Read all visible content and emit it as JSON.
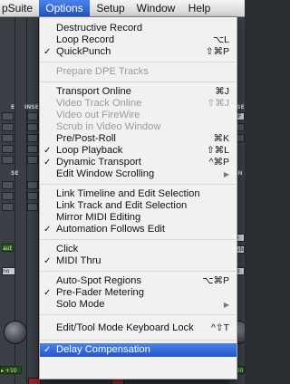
{
  "menubar": {
    "items": [
      "pSuite",
      "Options",
      "Setup",
      "Window",
      "Help"
    ]
  },
  "mixer": {
    "insert_label": "INSE",
    "insert_label_left": "E",
    "insert_label_right": "INSE",
    "sends_label": "SEN",
    "sends_label_left": "SE",
    "btn_solo": "S",
    "btn_mute": "M",
    "chip_aux_right": "AIF",
    "chip_ro": "ro",
    "chip_aubm": "aubm",
    "chip_no_left": "no",
    "chip_no_right": "no g",
    "level_left": "▸ +10",
    "level_right": "100",
    "auto_left": "aut"
  },
  "menu": {
    "items": [
      {
        "label": "Destructive Record",
        "checked": false,
        "disabled": false,
        "shortcut": "",
        "submenu": false
      },
      {
        "label": "Loop Record",
        "checked": false,
        "disabled": false,
        "shortcut": "⌥L",
        "submenu": false
      },
      {
        "label": "QuickPunch",
        "checked": true,
        "disabled": false,
        "shortcut": "⇧⌘P",
        "submenu": false
      },
      {
        "label": "Prepare DPE Tracks",
        "checked": false,
        "disabled": true,
        "shortcut": "",
        "submenu": false
      },
      {
        "label": "Transport Online",
        "checked": false,
        "disabled": false,
        "shortcut": "⌘J",
        "submenu": false
      },
      {
        "label": "Video Track Online",
        "checked": false,
        "disabled": true,
        "shortcut": "⇧⌘J",
        "submenu": false
      },
      {
        "label": "Video out FireWire",
        "checked": false,
        "disabled": true,
        "shortcut": "",
        "submenu": false
      },
      {
        "label": "Scrub in Video Window",
        "checked": false,
        "disabled": true,
        "shortcut": "",
        "submenu": false
      },
      {
        "label": "Pre/Post-Roll",
        "checked": false,
        "disabled": false,
        "shortcut": "⌘K",
        "submenu": false
      },
      {
        "label": "Loop Playback",
        "checked": true,
        "disabled": false,
        "shortcut": "⇧⌘L",
        "submenu": false
      },
      {
        "label": "Dynamic Transport",
        "checked": true,
        "disabled": false,
        "shortcut": "^⌘P",
        "submenu": false
      },
      {
        "label": "Edit Window Scrolling",
        "checked": false,
        "disabled": false,
        "shortcut": "",
        "submenu": true
      },
      {
        "label": "Link Timeline and Edit Selection",
        "checked": false,
        "disabled": false,
        "shortcut": "",
        "submenu": false
      },
      {
        "label": "Link Track and Edit Selection",
        "checked": false,
        "disabled": false,
        "shortcut": "",
        "submenu": false
      },
      {
        "label": "Mirror MIDI Editing",
        "checked": false,
        "disabled": false,
        "shortcut": "",
        "submenu": false
      },
      {
        "label": "Automation Follows Edit",
        "checked": true,
        "disabled": false,
        "shortcut": "",
        "submenu": false
      },
      {
        "label": "Click",
        "checked": false,
        "disabled": false,
        "shortcut": "",
        "submenu": false
      },
      {
        "label": "MIDI Thru",
        "checked": true,
        "disabled": false,
        "shortcut": "",
        "submenu": false
      },
      {
        "label": "Auto-Spot Regions",
        "checked": false,
        "disabled": false,
        "shortcut": "⌥⌘P",
        "submenu": false
      },
      {
        "label": "Pre-Fader Metering",
        "checked": true,
        "disabled": false,
        "shortcut": "",
        "submenu": false
      },
      {
        "label": "Solo Mode",
        "checked": false,
        "disabled": false,
        "shortcut": "",
        "submenu": true
      },
      {
        "label": "Edit/Tool Mode Keyboard Lock",
        "checked": false,
        "disabled": false,
        "shortcut": "^⇧T",
        "submenu": false
      },
      {
        "label": "Delay Compensation",
        "checked": true,
        "disabled": false,
        "shortcut": "",
        "submenu": false,
        "highlighted": true
      }
    ],
    "check_glyph": "✓",
    "submenu_glyph": "▶"
  },
  "colors": {
    "highlight": "#2d63d8",
    "menu_bg": "#f8f8f8",
    "mixer_bg": "#2c3036"
  }
}
